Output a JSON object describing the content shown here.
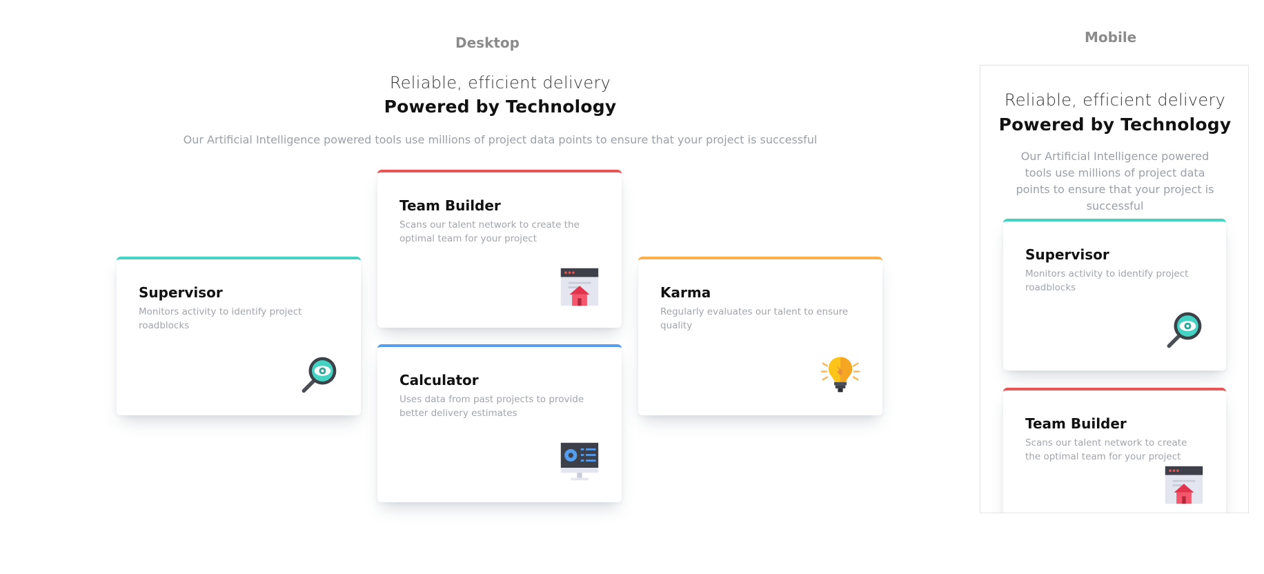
{
  "labels": {
    "desktop": "Desktop",
    "mobile": "Mobile"
  },
  "header": {
    "tagline": "Reliable, efficient delivery",
    "title": "Powered by Technology",
    "description": "Our Artificial Intelligence powered tools use millions of project data points to ensure that your project is successful"
  },
  "cards": [
    {
      "title": "Supervisor",
      "description": "Monitors activity to identify project roadblocks",
      "icon": "magnifier-eye-icon",
      "accent": "#44d3c2"
    },
    {
      "title": "Team Builder",
      "description": "Scans our talent network to create the optimal team for your project",
      "icon": "team-builder-window-icon",
      "accent": "#ea5454"
    },
    {
      "title": "Karma",
      "description": "Regularly evaluates our talent to ensure quality",
      "icon": "lightbulb-icon",
      "accent": "#fcaf4a"
    },
    {
      "title": "Calculator",
      "description": "Uses data from past projects to provide better delivery estimates",
      "icon": "calculator-monitor-icon",
      "accent": "#549ef2"
    }
  ],
  "mobile": {
    "tagline": "Reliable, efficient delivery",
    "title": "Powered by Technology",
    "description": "Our Artificial Intelligence powered tools use millions of project data points to ensure that your project is successful"
  }
}
